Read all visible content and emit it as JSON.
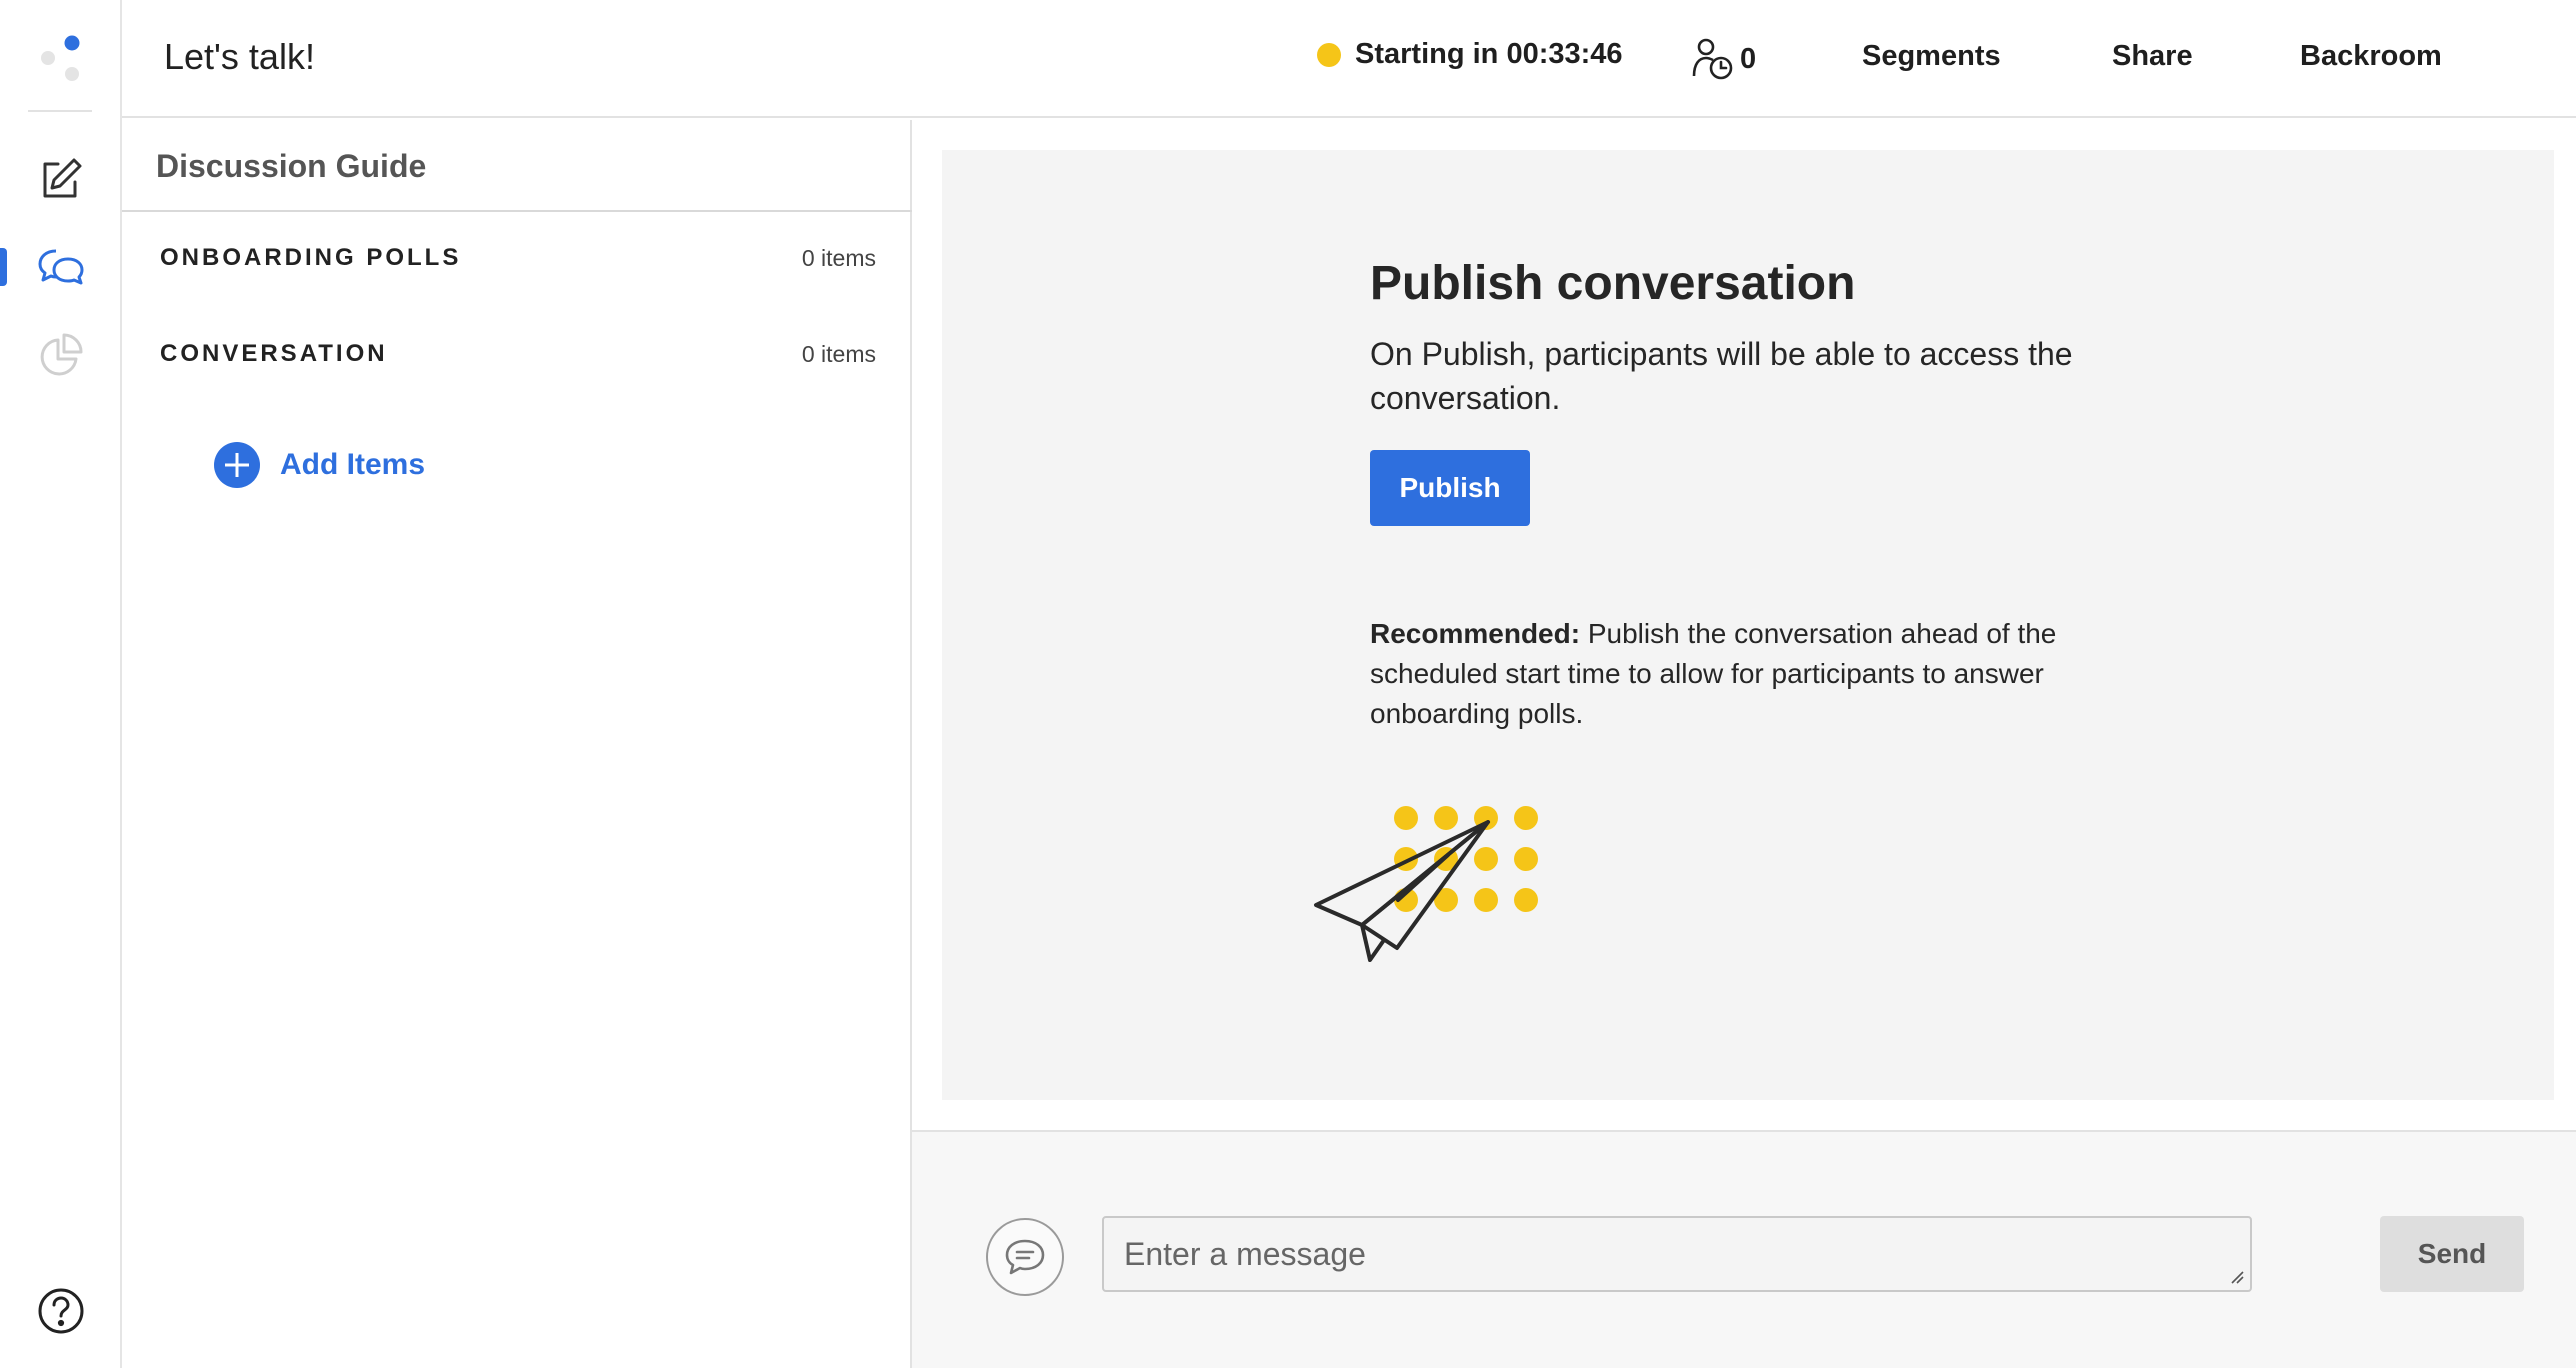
{
  "rail": {
    "icons": [
      "logo-icon",
      "edit-icon",
      "chat-bubbles-icon",
      "pie-chart-icon",
      "help-icon"
    ],
    "accent": "#2e6fde"
  },
  "header": {
    "title": "Let's talk!",
    "status": "Starting in 00:33:46",
    "status_color": "#f5c518",
    "waiting_count": "0",
    "nav": {
      "segments": "Segments",
      "share": "Share",
      "backroom": "Backroom"
    }
  },
  "guide": {
    "title": "Discussion Guide",
    "sections": [
      {
        "label": "ONBOARDING POLLS",
        "count": "0 items"
      },
      {
        "label": "CONVERSATION",
        "count": "0 items"
      }
    ],
    "add_items": "Add Items"
  },
  "main": {
    "title": "Publish conversation",
    "description": "On Publish, participants will be able to access the conversation.",
    "publish_label": "Publish",
    "recommend_label": "Recommended:",
    "recommend_text": " Publish the conversation ahead of the scheduled start time to allow for participants to answer onboarding polls.",
    "illustration_icons": [
      "paper-plane-icon",
      "dots-grid-icon"
    ],
    "illustration_color": "#f5c518"
  },
  "composer": {
    "placeholder": "Enter a message",
    "send_label": "Send"
  }
}
